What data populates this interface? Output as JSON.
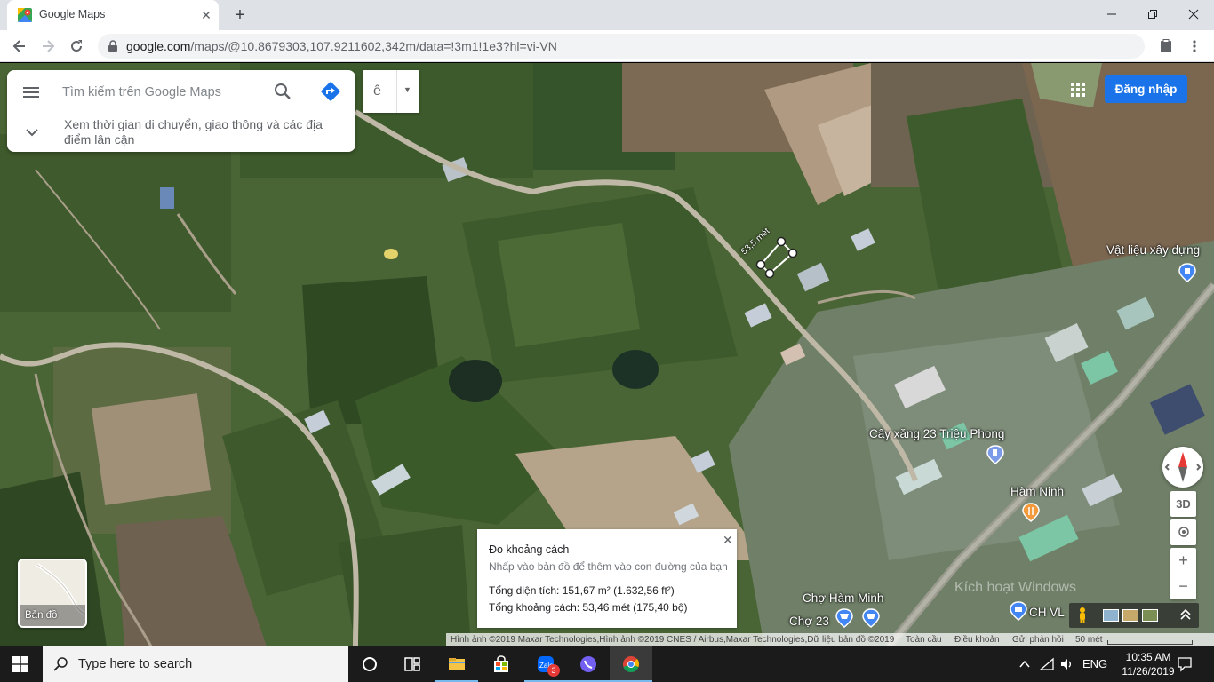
{
  "browser": {
    "tab_title": "Google Maps",
    "tab_close": "✕",
    "new_tab": "+",
    "url_host": "google.com",
    "url_rest": "/maps/@10.8679303,107.9211602,342m/data=!3m1!1e3?hl=vi-VN"
  },
  "search": {
    "placeholder": "Tìm kiếm trên Google Maps",
    "explore_text": "Xem thời gian di chuyển, giao thông và các địa điểm lân cận"
  },
  "ime": {
    "char": "ê",
    "arrow": "▼"
  },
  "header": {
    "signin_label": "Đăng nhập"
  },
  "layer": {
    "label": "Bản đồ"
  },
  "measure": {
    "close": "✕",
    "title": "Đo khoảng cách",
    "hint": "Nhấp vào bản đồ để thêm vào con đường của bạn",
    "area": "Tổng diện tích: 151,67 m² (1.632,56 ft²)",
    "distance": "Tổng khoảng cách: 53,46 mét (175,40 bộ)",
    "route_label": "53,5 mét"
  },
  "places": {
    "vat_lieu": "Vật liệu xây dựng",
    "cay_xang": "Cây xăng 23 Triệu Phong",
    "ham_ninh": "Hàm Ninh",
    "cho_ham_minh": "Chợ Hàm Minh",
    "cho_23": "Chợ 23",
    "ch_vl": "CH VL",
    "watermark": "Kích hoạt Windows"
  },
  "controls": {
    "three_d": "3D",
    "zoom_in": "+",
    "zoom_out": "−"
  },
  "attribution": {
    "imagery": "Hình ảnh ©2019 Maxar Technologies,Hình ảnh ©2019 CNES / Airbus,Maxar Technologies,Dữ liệu bản đồ ©2019",
    "global": "Toàn cầu",
    "terms": "Điều khoản",
    "feedback": "Gửi phản hồi",
    "scale": "50 mét"
  },
  "taskbar": {
    "search_placeholder": "Type here to search",
    "zalo_badge": "3",
    "lang": "ENG",
    "time": "10:35 AM",
    "date": "11/26/2019"
  },
  "colors": {
    "accent": "#1a73e8",
    "pin": "#4285f4",
    "food": "#f29a3b"
  }
}
